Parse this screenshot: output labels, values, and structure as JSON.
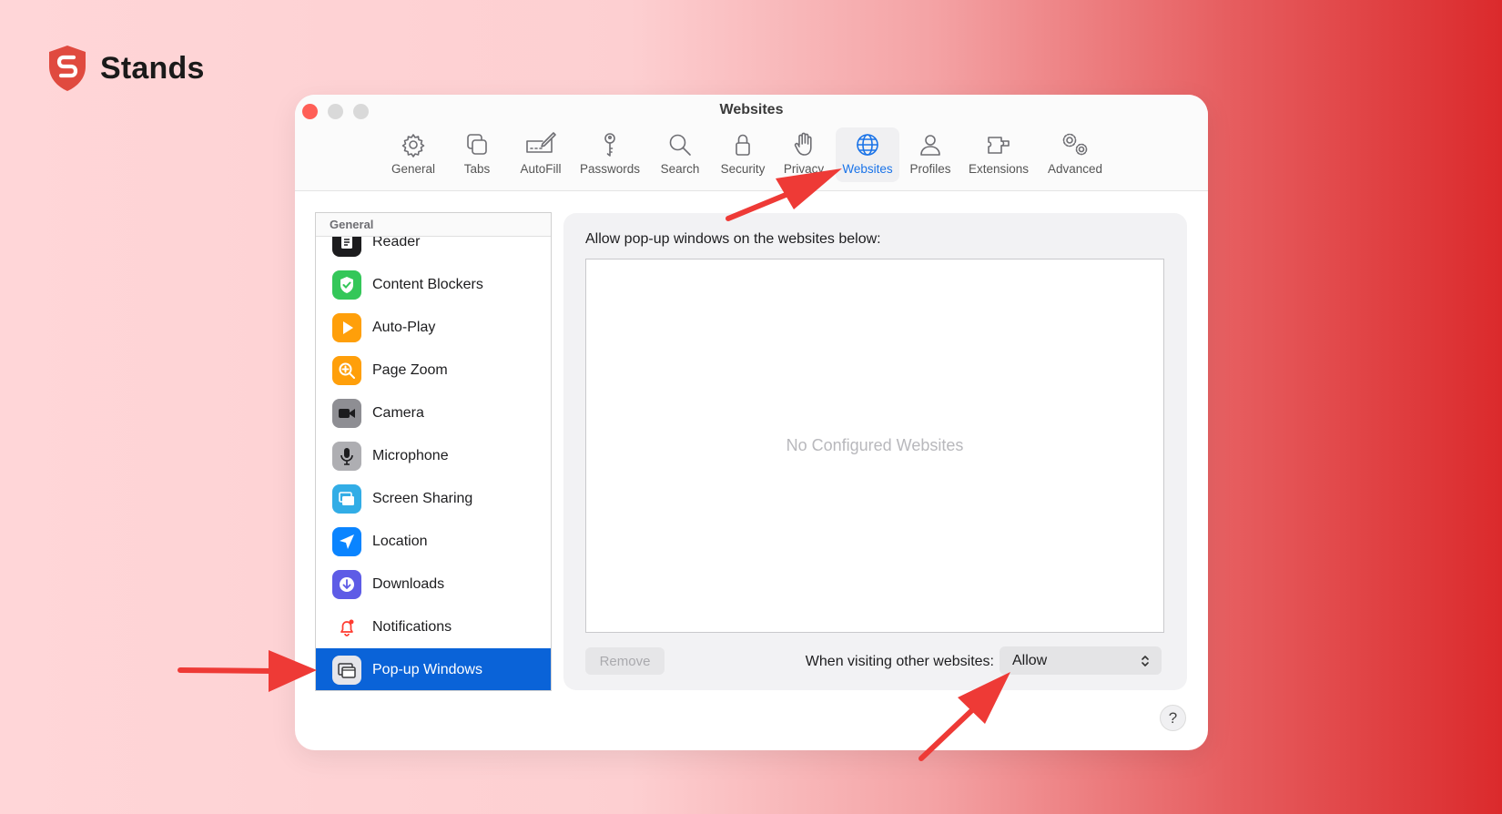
{
  "brand": {
    "name": "Stands",
    "color": "#e04a3f"
  },
  "window": {
    "title": "Websites"
  },
  "toolbar": {
    "tabs": [
      {
        "label": "General",
        "icon": "gear-icon"
      },
      {
        "label": "Tabs",
        "icon": "tabs-icon"
      },
      {
        "label": "AutoFill",
        "icon": "autofill-icon"
      },
      {
        "label": "Passwords",
        "icon": "key-icon"
      },
      {
        "label": "Search",
        "icon": "search-icon"
      },
      {
        "label": "Security",
        "icon": "lock-icon"
      },
      {
        "label": "Privacy",
        "icon": "hand-icon"
      },
      {
        "label": "Websites",
        "icon": "globe-icon",
        "active": true
      },
      {
        "label": "Profiles",
        "icon": "person-icon"
      },
      {
        "label": "Extensions",
        "icon": "puzzle-icon"
      },
      {
        "label": "Advanced",
        "icon": "gears-icon"
      }
    ],
    "active_color": "#1a73e8"
  },
  "sidebar": {
    "header": "General",
    "items": [
      {
        "label": "Reader",
        "icon": "reader-icon"
      },
      {
        "label": "Content Blockers",
        "icon": "shield-check-icon"
      },
      {
        "label": "Auto-Play",
        "icon": "play-icon"
      },
      {
        "label": "Page Zoom",
        "icon": "zoom-icon"
      },
      {
        "label": "Camera",
        "icon": "camera-icon"
      },
      {
        "label": "Microphone",
        "icon": "microphone-icon"
      },
      {
        "label": "Screen Sharing",
        "icon": "screen-share-icon"
      },
      {
        "label": "Location",
        "icon": "location-icon"
      },
      {
        "label": "Downloads",
        "icon": "download-icon"
      },
      {
        "label": "Notifications",
        "icon": "bell-icon"
      },
      {
        "label": "Pop-up Windows",
        "icon": "popup-windows-icon",
        "selected": true
      }
    ],
    "selected_color": "#0a63d8"
  },
  "main": {
    "label": "Allow pop-up windows on the websites below:",
    "empty_text": "No Configured Websites",
    "remove_label": "Remove",
    "visit_label": "When visiting other websites:",
    "visit_value": "Allow"
  },
  "help_label": "?",
  "annotation_color": "#ee3a36"
}
